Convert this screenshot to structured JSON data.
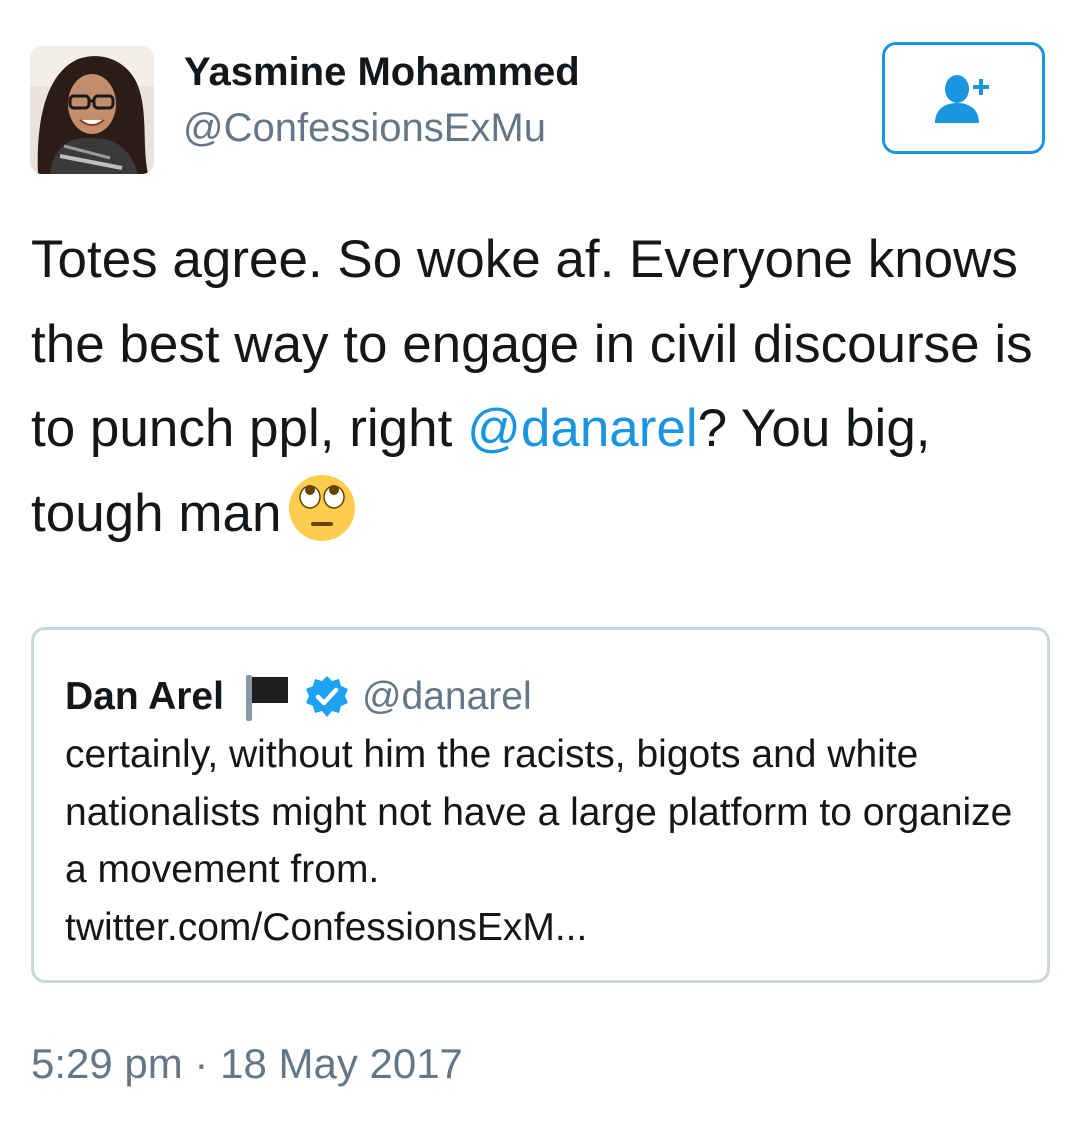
{
  "tweet": {
    "author_name": "Yasmine Mohammed",
    "author_handle": "@ConfessionsExMu",
    "follow_icon": "add-user-icon",
    "text_part1": "Totes agree. So woke af. Everyone knows the best way to engage in civil discourse is to punch ppl, right ",
    "mention": "@danarel",
    "text_part2": "? You big, tough man",
    "emoji": "face-with-rolling-eyes",
    "timestamp": "5:29 pm · 18 May 2017"
  },
  "quoted_tweet": {
    "author_name": "Dan Arel",
    "flag_icon": "black-flag-icon",
    "verified_icon": "verified-badge-icon",
    "author_handle": "@danarel",
    "text": "certainly, without him the racists, bigots and white nationalists might not have a large platform to organize a movement from.",
    "link": "twitter.com/ConfessionsExM..."
  },
  "colors": {
    "accent": "#1b95e0",
    "text": "#14171a",
    "secondary": "#657786",
    "border": "#ccd6dd"
  }
}
